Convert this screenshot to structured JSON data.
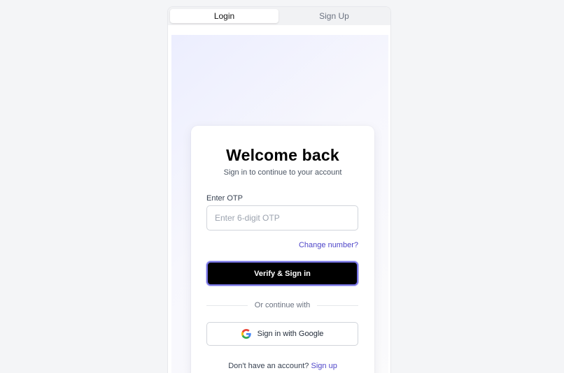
{
  "tabs": [
    {
      "label": "Login",
      "active": true
    },
    {
      "label": "Sign Up",
      "active": false
    }
  ],
  "card": {
    "title": "Welcome back",
    "subtitle": "Sign in to continue to your account",
    "otp": {
      "label": "Enter OTP",
      "placeholder": "Enter 6-digit OTP",
      "value": ""
    },
    "change_number": "Change number?",
    "verify_button": "Verify & Sign in",
    "divider_text": "Or continue with",
    "google_button": "Sign in with Google",
    "google_icon": "google-g-icon",
    "footer_text": "Don't have an account?",
    "footer_link": "Sign up"
  },
  "colors": {
    "accent": "#4f46c9",
    "primary_button": "#000000",
    "focus_ring": "#7673e4",
    "page_background": "#f4f5f7"
  }
}
